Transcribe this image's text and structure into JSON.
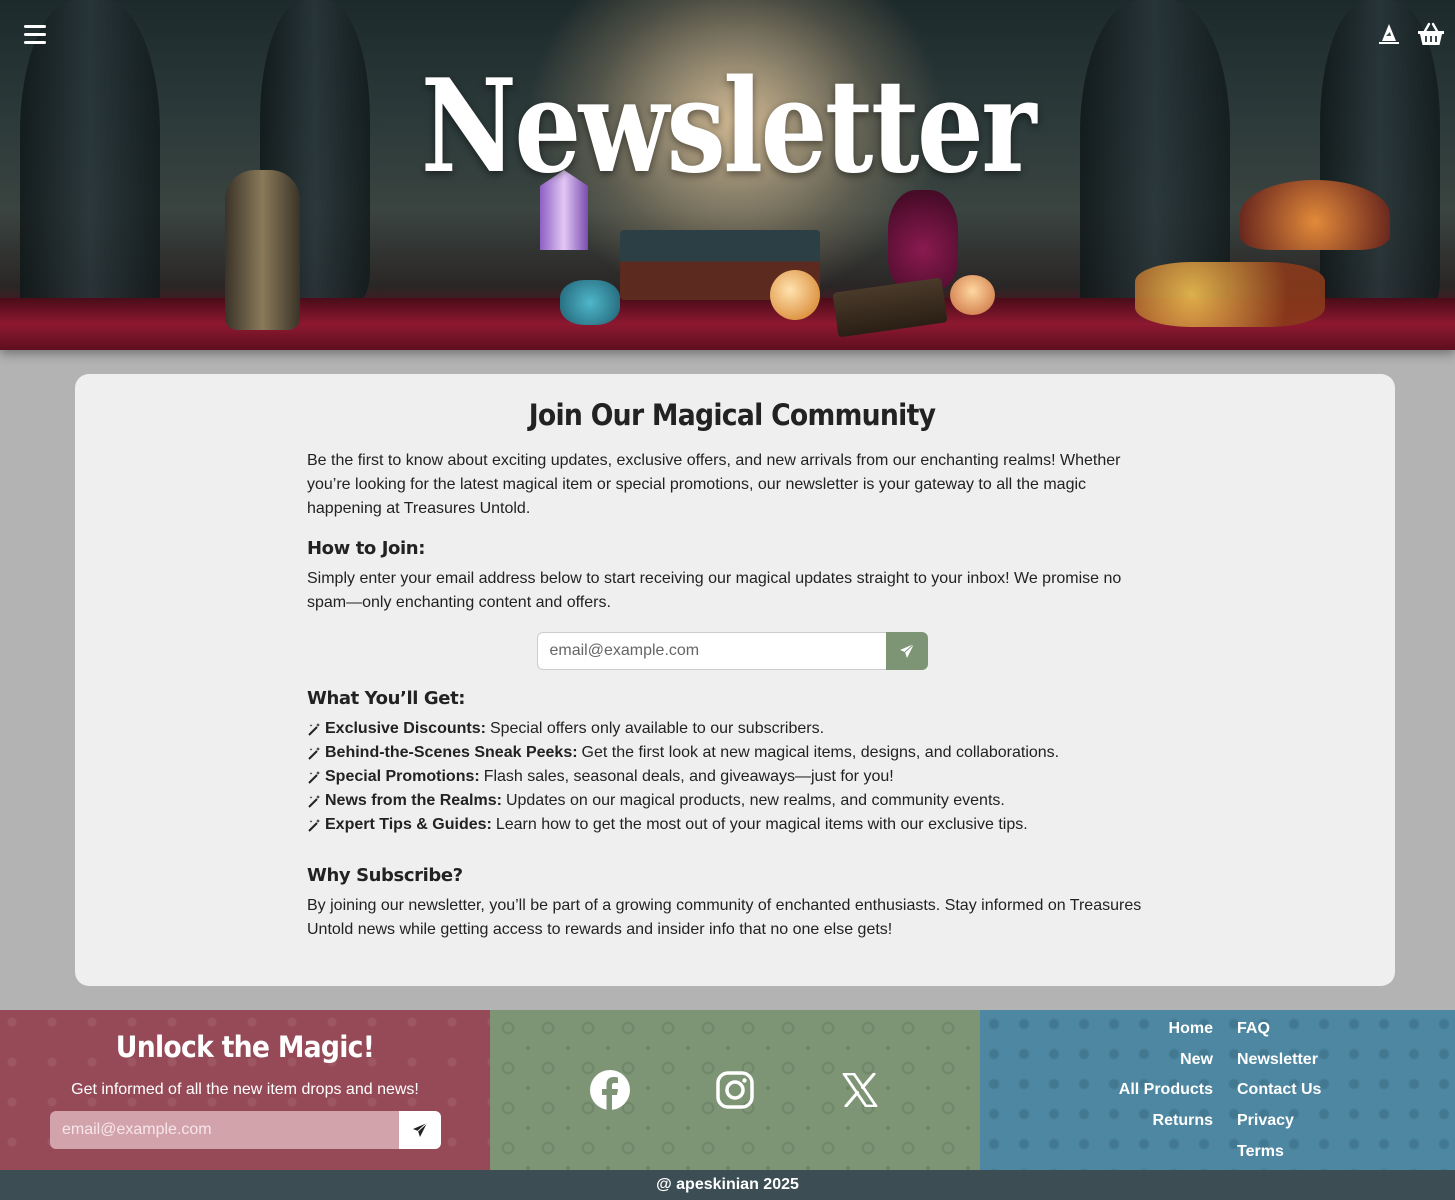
{
  "hero": {
    "title": "Newsletter",
    "menu_icon": "hamburger-menu-icon",
    "account_icon": "wizard-hat-icon",
    "cart_icon": "basket-icon"
  },
  "card": {
    "title": "Join Our Magical Community",
    "intro": "Be the first to know about exciting updates, exclusive offers, and new arrivals from our enchanting realms! Whether you’re looking for the latest magical item or special promotions, our newsletter is your gateway to all the magic happening at Treasures Untold.",
    "how_heading": "How to Join:",
    "how_text": "Simply enter your email address below to start receiving our magical updates straight to your inbox! We promise no spam—only enchanting content and offers.",
    "email_placeholder": "email@example.com",
    "submit_icon": "paper-plane-icon",
    "get_heading": "What You’ll Get:",
    "perks": [
      {
        "title": "Exclusive Discounts:",
        "text": "Special offers only available to our subscribers."
      },
      {
        "title": "Behind-the-Scenes Sneak Peeks:",
        "text": "Get the first look at new magical items, designs, and collaborations."
      },
      {
        "title": "Special Promotions:",
        "text": "Flash sales, seasonal deals, and giveaways—just for you!"
      },
      {
        "title": "News from the Realms:",
        "text": "Updates on our magical products, new realms, and community events."
      },
      {
        "title": "Expert Tips & Guides:",
        "text": "Learn how to get the most out of your magical items with our exclusive tips."
      }
    ],
    "why_heading": "Why Subscribe?",
    "why_text": "By joining our newsletter, you’ll be part of a growing community of enchanted enthusiasts. Stay informed on Treasures Untold news while getting access to rewards and insider info that no one else gets!"
  },
  "footer": {
    "unlock_title": "Unlock the Magic!",
    "unlock_sub": "Get informed of all the new item drops and news!",
    "email_placeholder": "email@example.com",
    "socials": [
      "facebook-icon",
      "instagram-icon",
      "x-twitter-icon"
    ],
    "links_right": [
      "Home",
      "New",
      "All Products",
      "Returns"
    ],
    "links_left": [
      "FAQ",
      "Newsletter",
      "Contact Us",
      "Privacy",
      "Terms"
    ],
    "copyright": "@ apeskinian 2025"
  },
  "colors": {
    "card_bg": "#efefef",
    "page_bg": "#b3b3b3",
    "sage": "#7d9575",
    "rose": "#964a57",
    "teal": "#4d87a1",
    "bar": "#3c4d53"
  }
}
